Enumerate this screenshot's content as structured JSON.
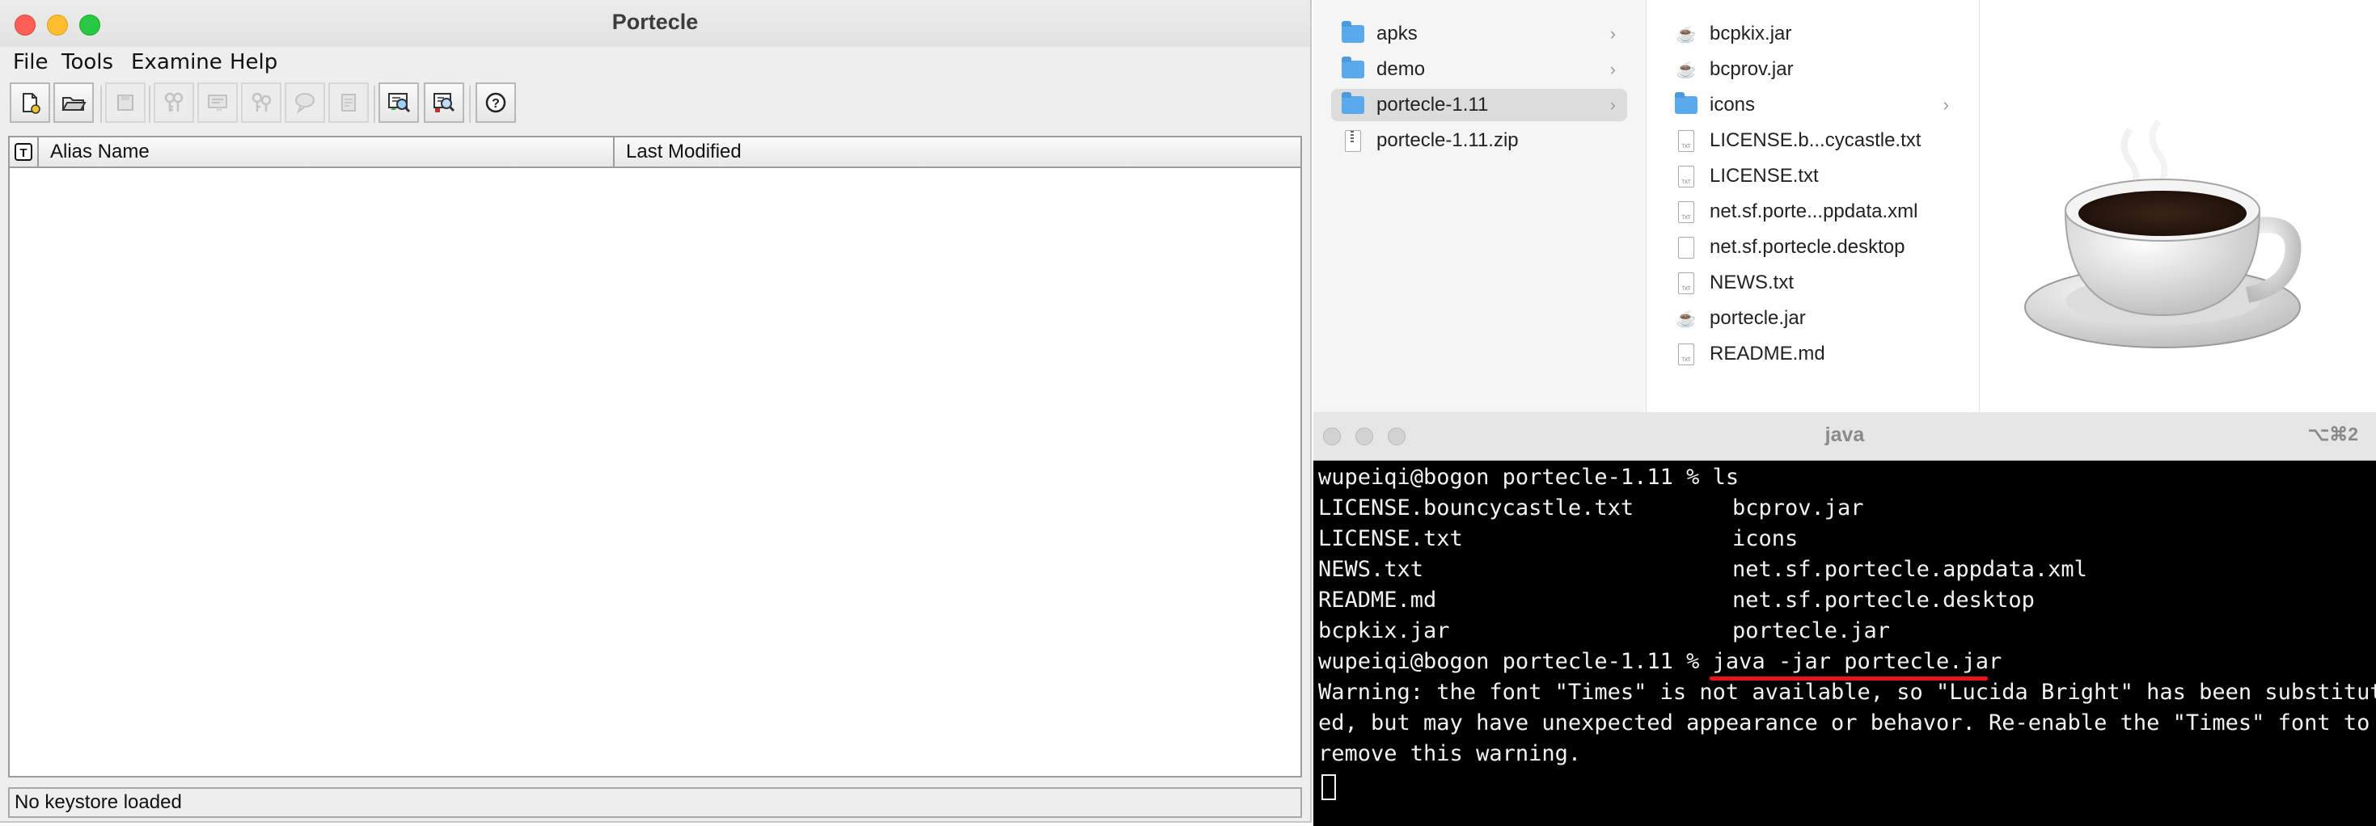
{
  "portecle": {
    "title": "Portecle",
    "menus": [
      "File",
      "Tools",
      "Examine",
      "Help"
    ],
    "table_headers": [
      "Alias Name",
      "Last Modified"
    ],
    "status": "No keystore loaded"
  },
  "finder": {
    "col1": [
      {
        "name": "apks",
        "kind": "folder",
        "selected": false
      },
      {
        "name": "demo",
        "kind": "folder",
        "selected": false
      },
      {
        "name": "portecle-1.11",
        "kind": "folder",
        "selected": true
      },
      {
        "name": "portecle-1.11.zip",
        "kind": "zip",
        "selected": false
      }
    ],
    "col2": [
      {
        "name": "bcpkix.jar",
        "kind": "jar"
      },
      {
        "name": "bcprov.jar",
        "kind": "jar"
      },
      {
        "name": "icons",
        "kind": "folder"
      },
      {
        "name": "LICENSE.b...cycastle.txt",
        "kind": "txt"
      },
      {
        "name": "LICENSE.txt",
        "kind": "txt"
      },
      {
        "name": "net.sf.porte...ppdata.xml",
        "kind": "txt"
      },
      {
        "name": "net.sf.portecle.desktop",
        "kind": "blank"
      },
      {
        "name": "NEWS.txt",
        "kind": "txt"
      },
      {
        "name": "portecle.jar",
        "kind": "jar"
      },
      {
        "name": "README.md",
        "kind": "txt"
      }
    ]
  },
  "terminal": {
    "title": "java",
    "shortcut": "⌥⌘2",
    "prompt1": "wupeiqi@bogon portecle-1.11 % ls",
    "ls_left": [
      "LICENSE.bouncycastle.txt",
      "LICENSE.txt",
      "NEWS.txt",
      "README.md",
      "bcpkix.jar"
    ],
    "ls_right": [
      "bcprov.jar",
      "icons",
      "net.sf.portecle.appdata.xml",
      "net.sf.portecle.desktop",
      "portecle.jar"
    ],
    "prompt2": "wupeiqi@bogon portecle-1.11 % ",
    "command": "java -jar portecle.jar",
    "warning": [
      "Warning: the font \"Times\" is not available, so \"Lucida Bright\" has been substitut",
      "ed, but may have unexpected appearance or behavor. Re-enable the \"Times\" font to",
      "remove this warning."
    ]
  }
}
